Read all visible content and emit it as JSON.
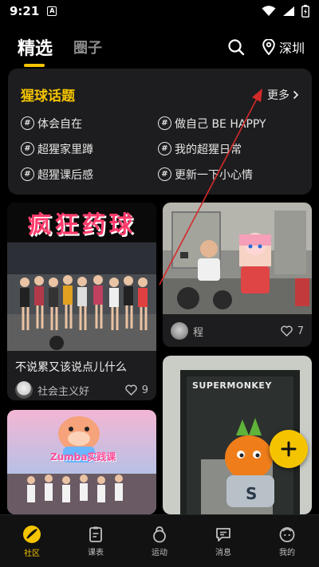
{
  "status_bar": {
    "time": "9:21",
    "badge": "A"
  },
  "header": {
    "tabs": [
      {
        "label": "精选"
      },
      {
        "label": "圈子"
      }
    ],
    "location": "深圳"
  },
  "topics": {
    "title": "猩球话题",
    "more": "更多",
    "items": [
      {
        "label": "体会自在"
      },
      {
        "label": "做自己 BE HAPPY"
      },
      {
        "label": "超猩家里蹲"
      },
      {
        "label": "我的超猩日常"
      },
      {
        "label": "超猩课后感"
      },
      {
        "label": "更新一下小心情"
      }
    ]
  },
  "feed": {
    "post1": {
      "banner": "疯狂药球",
      "title": "不说累又该说点儿什么",
      "author": "社会主义好",
      "likes": "9"
    },
    "post2": {
      "author": "程",
      "likes": "7"
    },
    "post3": {
      "banner": "Zumba实践课"
    },
    "post4": {
      "sign": "SUPERMONKEY"
    }
  },
  "bottom_nav": [
    {
      "label": "社区"
    },
    {
      "label": "课表"
    },
    {
      "label": "运动"
    },
    {
      "label": "消息"
    },
    {
      "label": "我的"
    }
  ],
  "colors": {
    "accent": "#f5c400",
    "background": "#000000",
    "card": "#1d1d1f",
    "annotation": "#d42a2a"
  }
}
